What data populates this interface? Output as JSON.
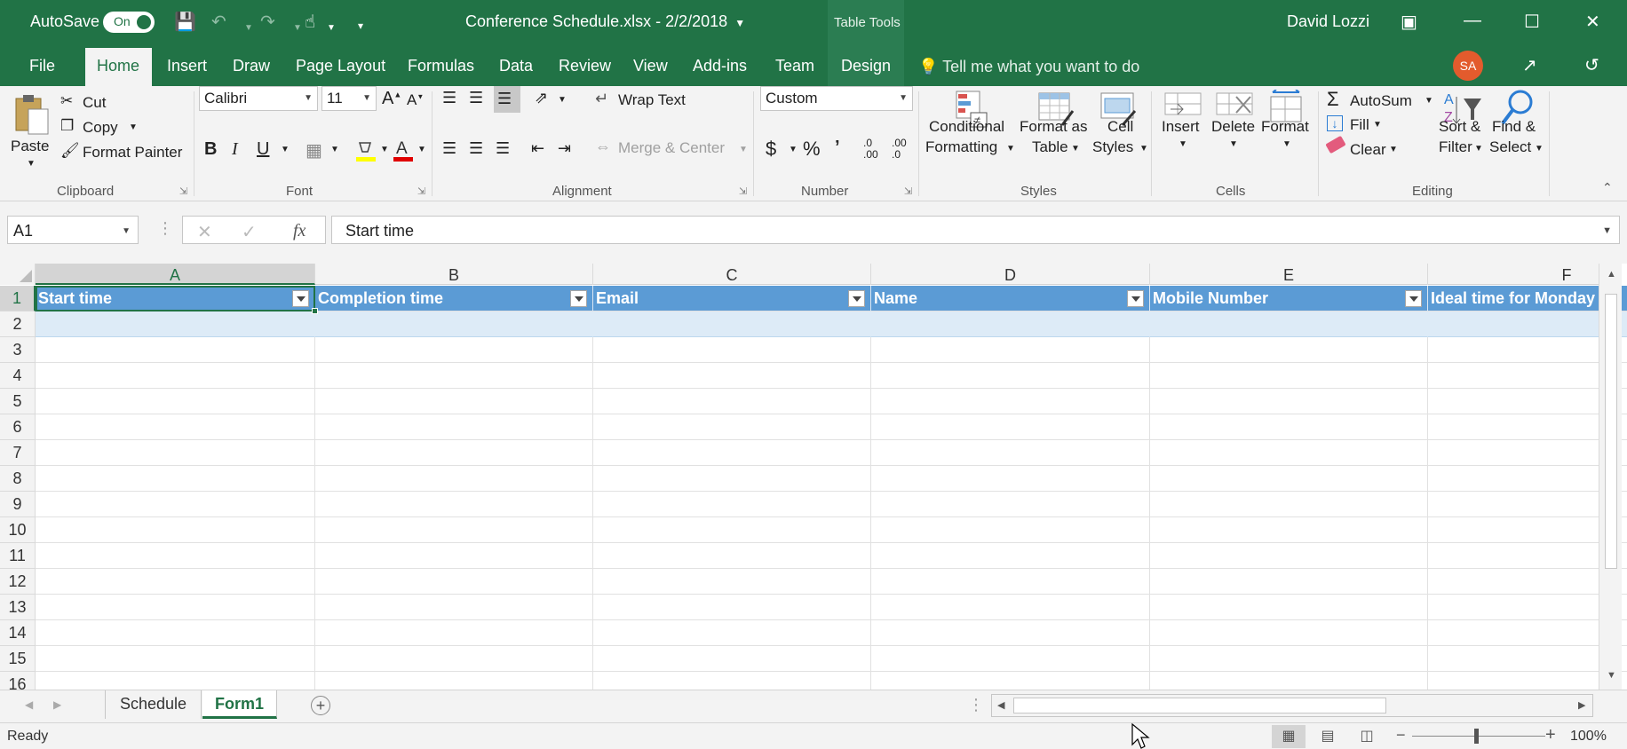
{
  "titlebar": {
    "autosave_label": "AutoSave",
    "autosave_state": "On",
    "doc_title": "Conference Schedule.xlsx  -  2/2/2018",
    "contextual_group": "Table Tools",
    "user_name": "David Lozzi"
  },
  "tabs": [
    "File",
    "Home",
    "Insert",
    "Draw",
    "Page Layout",
    "Formulas",
    "Data",
    "Review",
    "View",
    "Add-ins",
    "Team",
    "Design"
  ],
  "active_tab": "Home",
  "tell_me": "Tell me what you want to do",
  "avatar_initials": "SA",
  "ribbon": {
    "clipboard": {
      "paste": "Paste",
      "cut": "Cut",
      "copy": "Copy",
      "format_painter": "Format Painter",
      "label": "Clipboard"
    },
    "font": {
      "family": "Calibri",
      "size": "11",
      "label": "Font",
      "bold": "B",
      "italic": "I",
      "underline": "U"
    },
    "alignment": {
      "wrap_text": "Wrap Text",
      "merge_center": "Merge & Center",
      "label": "Alignment"
    },
    "number": {
      "format": "Custom",
      "label": "Number",
      "currency": "$",
      "percent": "%",
      "comma": "’",
      "inc_dec": ".0\n.00",
      "dec_dec": ".00\n.0"
    },
    "styles": {
      "conditional_1": "Conditional",
      "conditional_2": "Formatting",
      "format_table_1": "Format as",
      "format_table_2": "Table",
      "cell_styles_1": "Cell",
      "cell_styles_2": "Styles",
      "label": "Styles"
    },
    "cells": {
      "insert": "Insert",
      "delete": "Delete",
      "format": "Format",
      "label": "Cells"
    },
    "editing": {
      "autosum": "AutoSum",
      "fill": "Fill",
      "clear": "Clear",
      "sort_1": "Sort &",
      "sort_2": "Filter",
      "find_1": "Find &",
      "find_2": "Select",
      "label": "Editing"
    }
  },
  "formula_bar": {
    "name_box": "A1",
    "fx": "fx",
    "content": "Start time"
  },
  "grid": {
    "columns": [
      "A",
      "B",
      "C",
      "D",
      "E",
      "F"
    ],
    "header_cells": [
      "Start time",
      "Completion time",
      "Email",
      "Name",
      "Mobile Number",
      "Ideal time for Monday"
    ],
    "row_numbers": [
      "1",
      "2",
      "3",
      "4",
      "5",
      "6",
      "7",
      "8",
      "9",
      "10",
      "11",
      "12",
      "13",
      "14",
      "15",
      "16"
    ]
  },
  "sheets": [
    "Schedule",
    "Form1"
  ],
  "active_sheet": "Form1",
  "status": {
    "text": "Ready",
    "zoom": "100%"
  },
  "colors": {
    "accent": "#217346",
    "table_header": "#5b9bd5",
    "table_band": "#ddebf7"
  }
}
